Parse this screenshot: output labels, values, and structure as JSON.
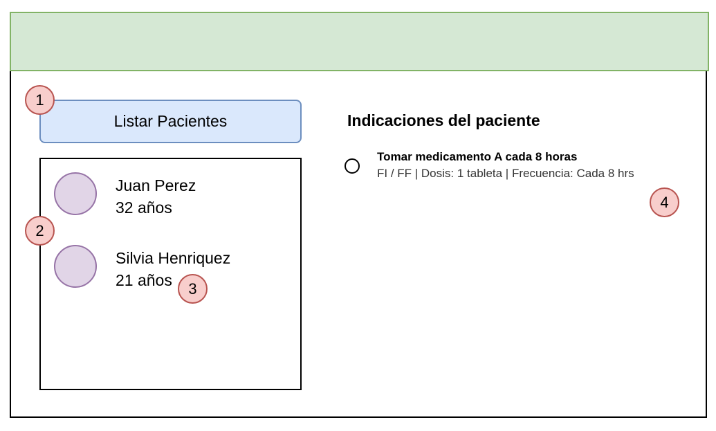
{
  "header": {
    "color": "#d5e8d4",
    "border": "#82b366"
  },
  "list_button": {
    "label": "Listar Pacientes"
  },
  "patients": [
    {
      "name": "Juan Perez",
      "age": "32 años"
    },
    {
      "name": "Silvia Henriquez",
      "age": "21 años"
    }
  ],
  "indications": {
    "title": "Indicaciones del paciente",
    "items": [
      {
        "title": "Tomar medicamento A cada 8 horas",
        "detail": "FI / FF | Dosis: 1 tableta | Frecuencia: Cada 8 hrs"
      }
    ]
  },
  "markers": [
    "1",
    "2",
    "3",
    "4"
  ]
}
